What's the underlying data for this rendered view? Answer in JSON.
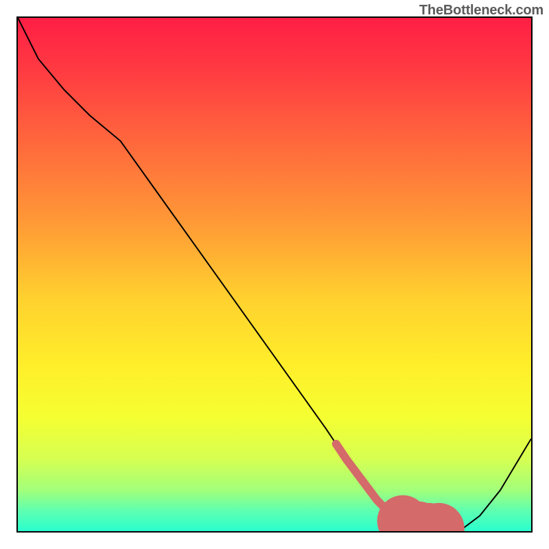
{
  "watermark": "TheBottleneck.com",
  "chart_data": {
    "type": "line",
    "title": "",
    "xlabel": "",
    "ylabel": "",
    "xlim": [
      0,
      100
    ],
    "ylim": [
      0,
      100
    ],
    "x": [
      0,
      4,
      9,
      14,
      20,
      25,
      30,
      35,
      40,
      45,
      50,
      55,
      60,
      62,
      64,
      67,
      70,
      72,
      75,
      78,
      80,
      83,
      86,
      90,
      94,
      97,
      100
    ],
    "y": [
      100,
      92,
      86,
      81,
      76,
      69,
      62,
      55,
      48,
      41,
      34,
      27,
      20,
      17,
      14,
      10,
      6,
      4,
      2,
      1,
      0,
      0,
      0,
      3,
      8,
      13,
      18
    ],
    "series": [
      {
        "name": "bottleneck-curve",
        "color": "#000000",
        "width": 2,
        "x": [
          0,
          4,
          9,
          14,
          20,
          25,
          30,
          35,
          40,
          45,
          50,
          55,
          60,
          62,
          64,
          67,
          70,
          72,
          75,
          78,
          80,
          83,
          86,
          90,
          94,
          97,
          100
        ],
        "y": [
          100,
          92,
          86,
          81,
          76,
          69,
          62,
          55,
          48,
          41,
          34,
          27,
          20,
          17,
          14,
          10,
          6,
          4,
          2,
          1,
          0,
          0,
          0,
          3,
          8,
          13,
          18
        ]
      },
      {
        "name": "highlight-segment",
        "color": "#d46a6a",
        "width": 12,
        "x": [
          62,
          64,
          67,
          70,
          72,
          75,
          78,
          80,
          82
        ],
        "y": [
          17,
          14,
          10,
          6,
          4,
          2,
          0.8,
          0.5,
          0.5
        ],
        "style": "dotted-tail"
      }
    ],
    "background_gradient": {
      "stops": [
        {
          "pos": 0.0,
          "color": "#ff1e45"
        },
        {
          "pos": 0.1,
          "color": "#ff3a42"
        },
        {
          "pos": 0.25,
          "color": "#ff6a3c"
        },
        {
          "pos": 0.4,
          "color": "#ff9a36"
        },
        {
          "pos": 0.55,
          "color": "#ffd22e"
        },
        {
          "pos": 0.68,
          "color": "#ffef2a"
        },
        {
          "pos": 0.78,
          "color": "#f4ff32"
        },
        {
          "pos": 0.86,
          "color": "#d6ff52"
        },
        {
          "pos": 0.92,
          "color": "#a2ff7a"
        },
        {
          "pos": 0.96,
          "color": "#5fffb0"
        },
        {
          "pos": 1.0,
          "color": "#2affcf"
        }
      ]
    }
  }
}
